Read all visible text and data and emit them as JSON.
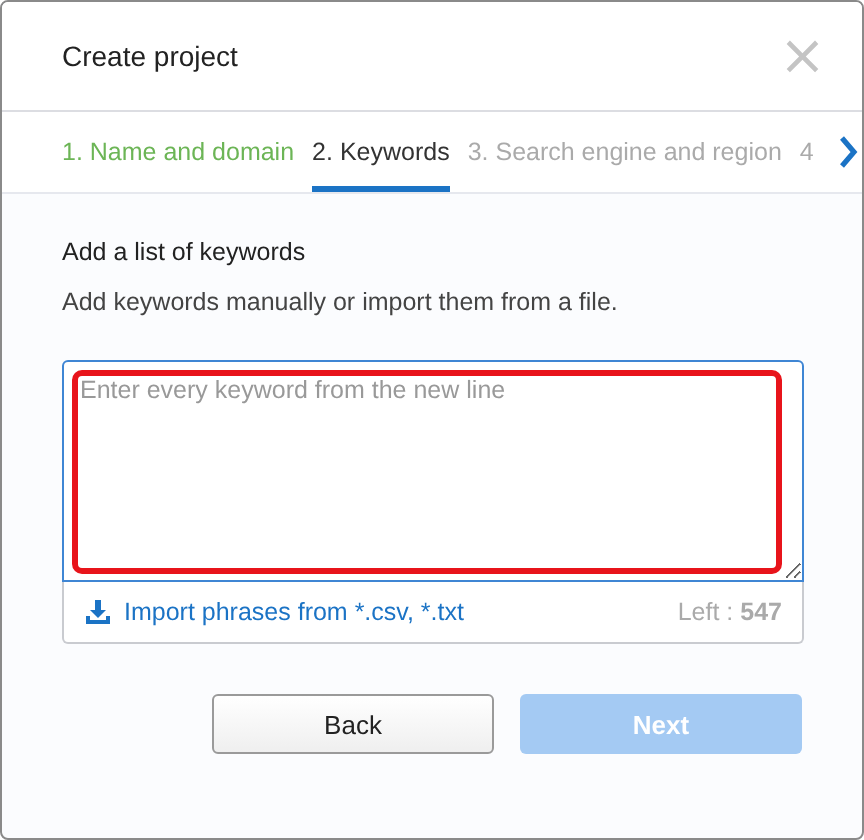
{
  "dialog": {
    "title": "Create project",
    "close": "×"
  },
  "steps": [
    {
      "label": "1. Name and domain",
      "done": true,
      "selected": false
    },
    {
      "label": "2. Keywords",
      "done": false,
      "selected": true
    },
    {
      "label": "3. Search engine and region",
      "done": false,
      "selected": false
    },
    {
      "label": "4",
      "done": false,
      "selected": false
    }
  ],
  "section": {
    "heading": "Add a list of keywords",
    "description": "Add keywords manually or import them from a file."
  },
  "keywords": {
    "placeholder": "Enter every keyword from the new line",
    "highlighted": true
  },
  "import_link": "Import phrases from *.csv, *.txt",
  "left": {
    "label": "Left : ",
    "count": "547"
  },
  "buttons": [
    {
      "label": "Back",
      "kind": "secondary",
      "disabled": false
    },
    {
      "label": "Next",
      "kind": "primary",
      "disabled": true
    }
  ]
}
